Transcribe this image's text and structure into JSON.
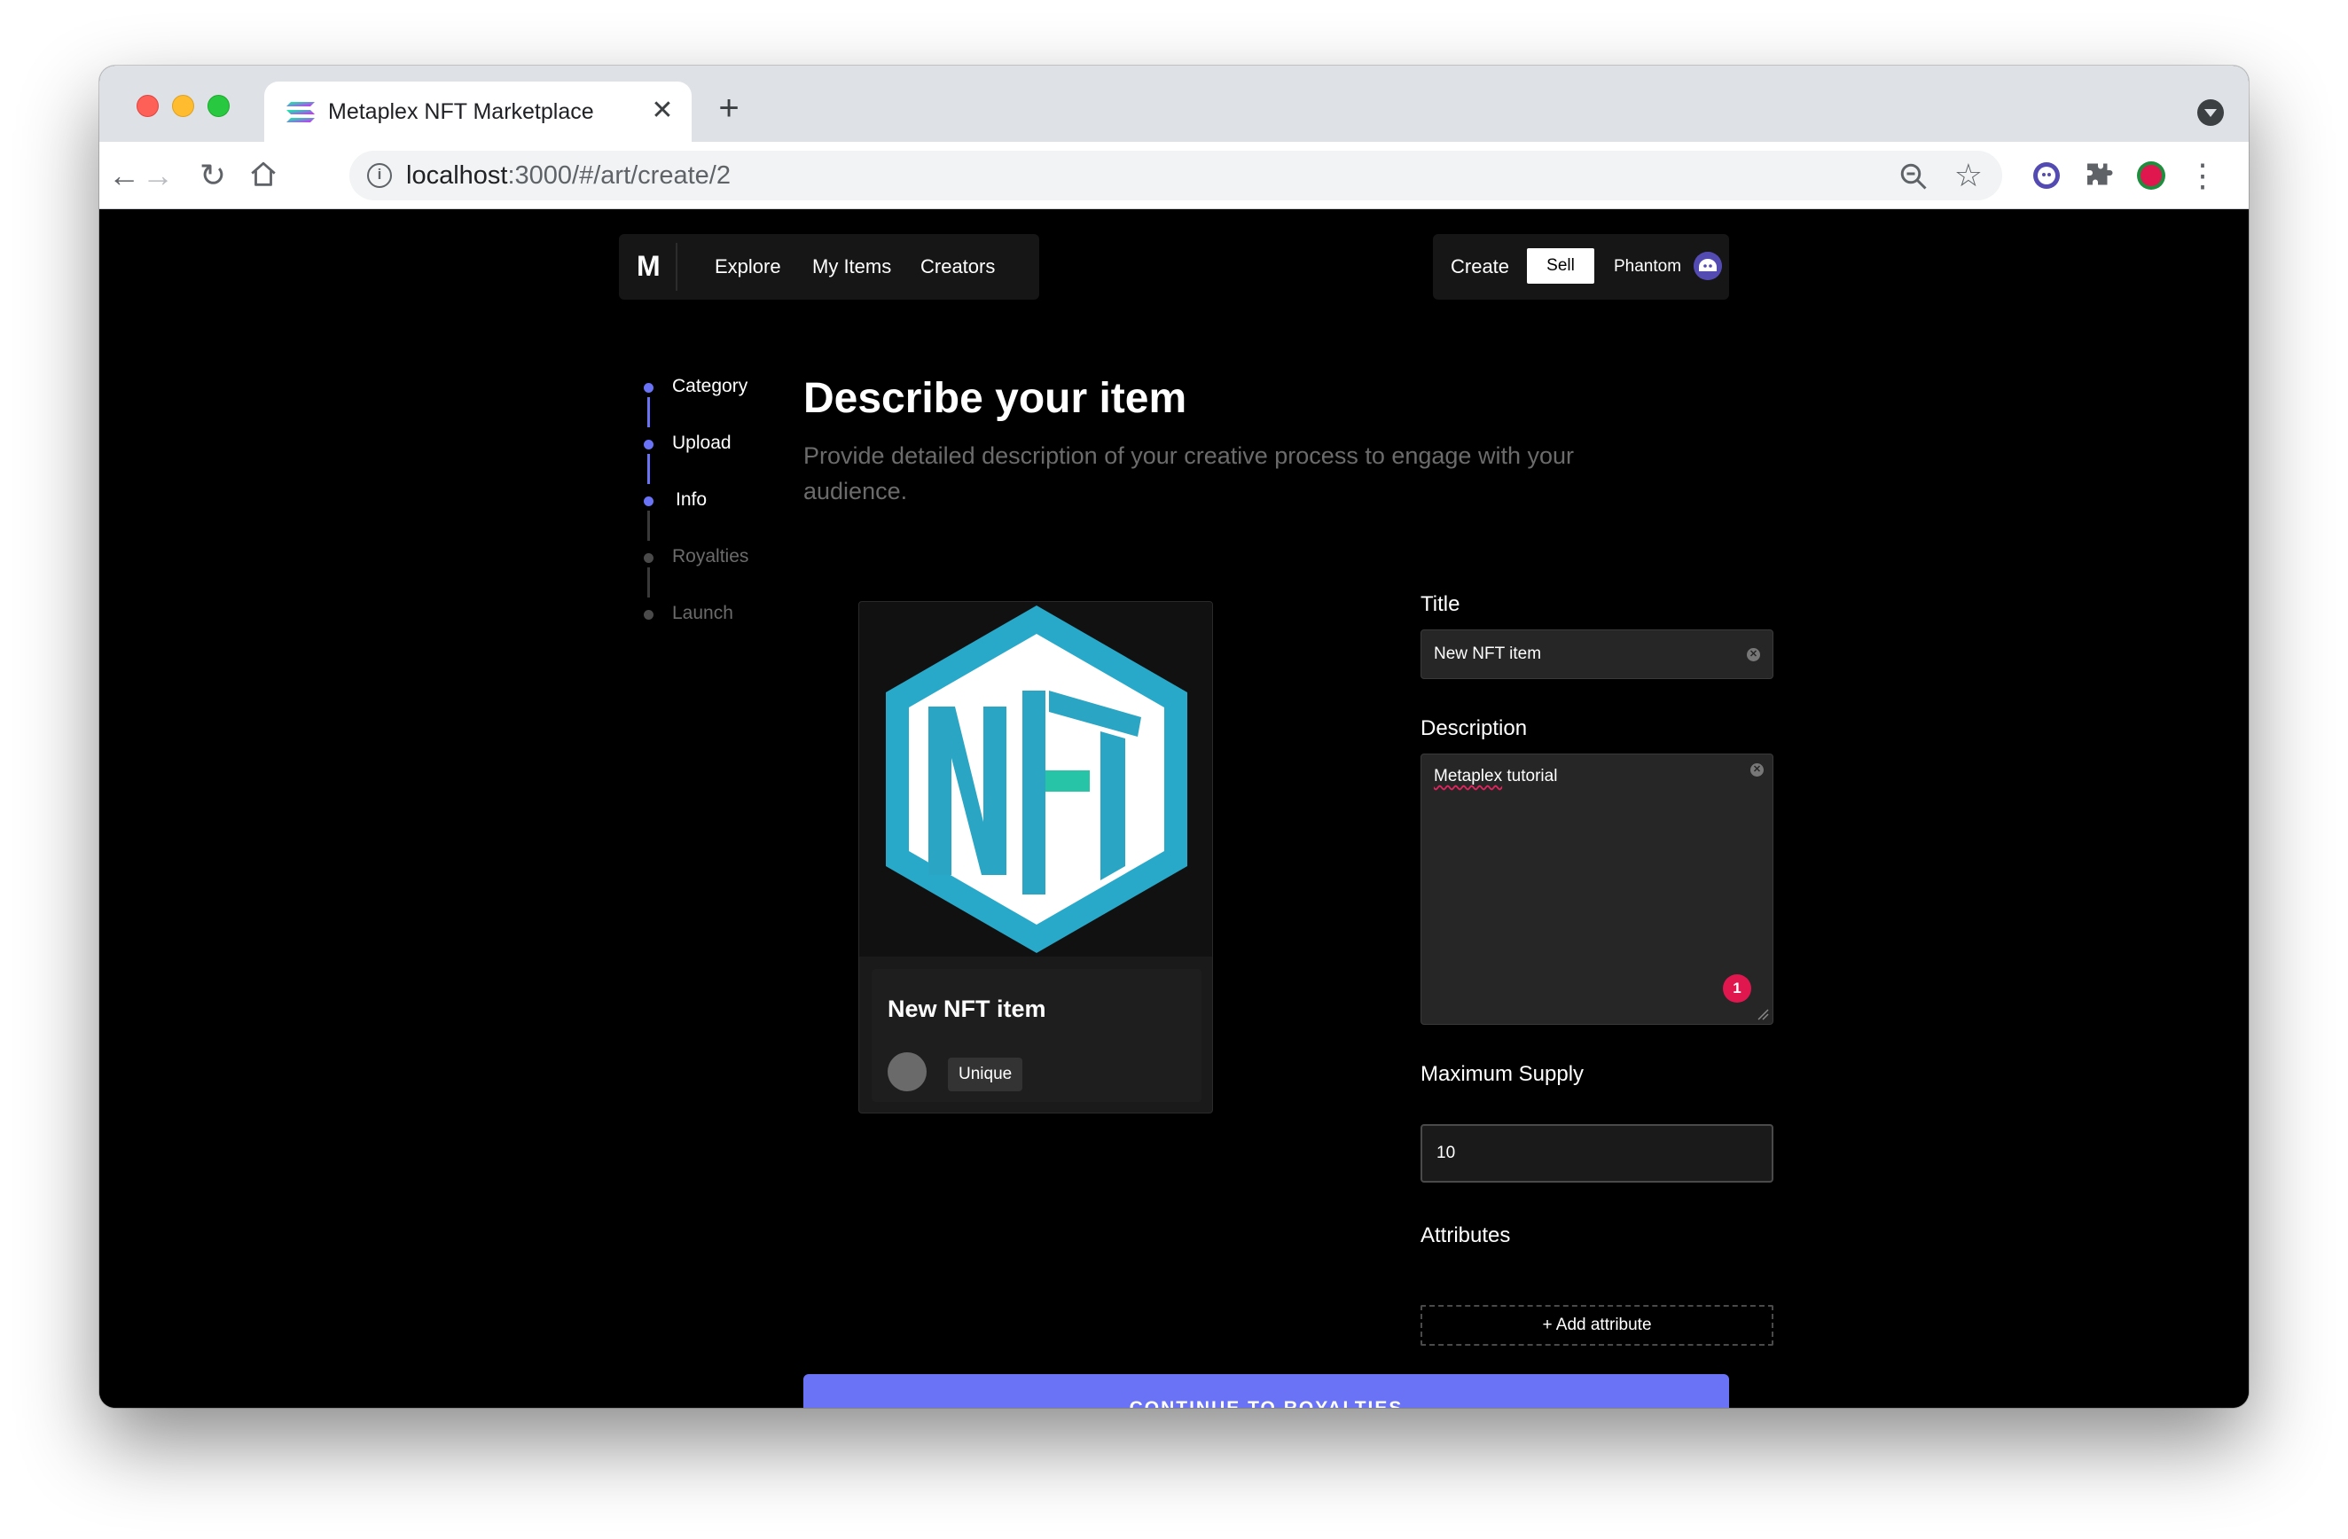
{
  "browser": {
    "tab_title": "Metaplex NFT Marketplace",
    "tab_close": "✕",
    "new_tab": "+",
    "url_host": "localhost",
    "url_path": ":3000/#/art/create/2",
    "back": "←",
    "forward": "→",
    "reload": "↻",
    "star": "☆",
    "menu": "⋮"
  },
  "nav": {
    "logo": "M",
    "links": [
      "Explore",
      "My Items",
      "Creators"
    ],
    "create": "Create",
    "sell": "Sell",
    "wallet": "Phantom"
  },
  "steps": [
    {
      "label": "Category",
      "state": "done"
    },
    {
      "label": "Upload",
      "state": "done"
    },
    {
      "label": "Info",
      "state": "active"
    },
    {
      "label": "Royalties",
      "state": "pending"
    },
    {
      "label": "Launch",
      "state": "pending"
    }
  ],
  "main": {
    "heading": "Describe your item",
    "subheading": "Provide detailed description of your creative process to engage with your audience."
  },
  "card": {
    "image_text": "NFT",
    "title": "New NFT item",
    "badge": "Unique"
  },
  "form": {
    "title_label": "Title",
    "title_value": "New NFT item",
    "description_label": "Description",
    "description_value_word1": "Metaplex",
    "description_value_word2": " tutorial",
    "error_count": "1",
    "supply_label": "Maximum Supply",
    "supply_value": "10",
    "attributes_label": "Attributes",
    "add_attribute": "+ Add attribute"
  },
  "cta": "CONTINUE TO ROYALTIES",
  "colors": {
    "accent": "#6a73f6",
    "step_active": "#6a73f6",
    "step_pending": "#4a4a4a",
    "nft_blue": "#29a9c9",
    "nft_teal": "#27b7b0"
  },
  "icons": [
    "solana-icon",
    "info-icon",
    "zoom-icon",
    "star-icon",
    "phantom-icon",
    "puzzle-icon",
    "profile-icon",
    "kebab-icon",
    "home-icon"
  ]
}
